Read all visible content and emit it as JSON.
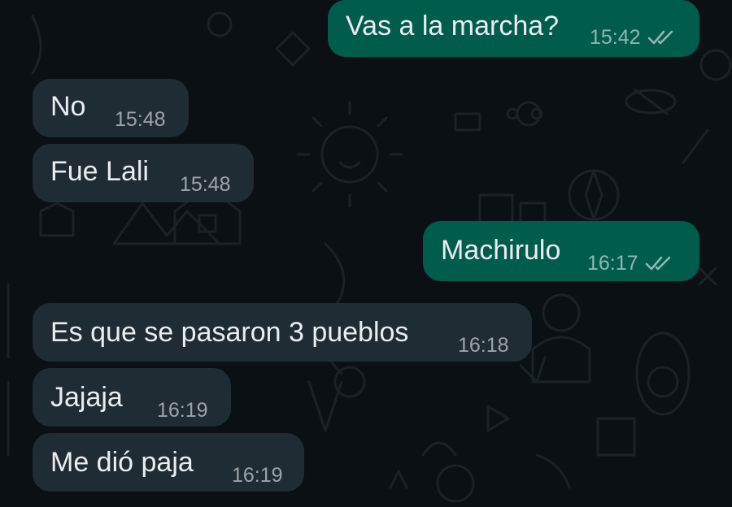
{
  "messages": [
    {
      "text": "Vas a la marcha?",
      "time": "15:42",
      "dir": "out",
      "status": "double-check-icon"
    },
    {
      "text": "No",
      "time": "15:48",
      "dir": "in"
    },
    {
      "text": "Fue Lali",
      "time": "15:48",
      "dir": "in"
    },
    {
      "text": "Machirulo",
      "time": "16:17",
      "dir": "out",
      "status": "double-check-icon"
    },
    {
      "text": "Es que se pasaron 3 pueblos",
      "time": "16:18",
      "dir": "in"
    },
    {
      "text": "Jajaja",
      "time": "16:19",
      "dir": "in"
    },
    {
      "text": "Me dió paja",
      "time": "16:19",
      "dir": "in"
    }
  ],
  "colors": {
    "background": "#0b1014",
    "incoming_bubble": "#1f2c33",
    "outgoing_bubble": "#005c4b",
    "text": "#e9edef"
  }
}
